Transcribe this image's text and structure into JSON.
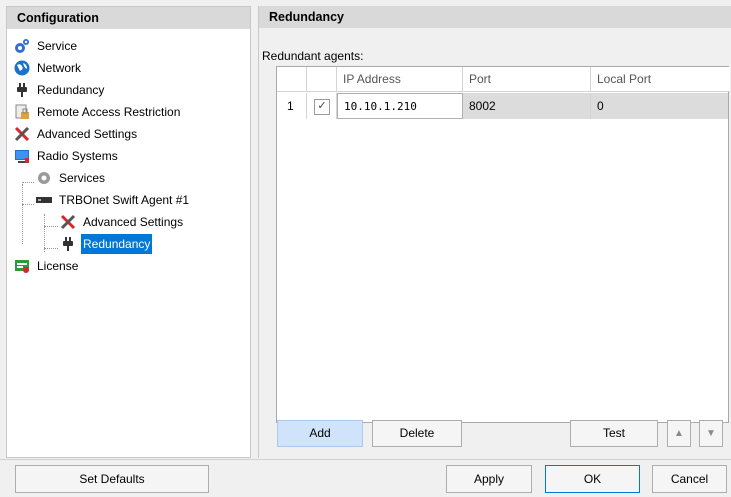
{
  "left_panel": {
    "title": "Configuration",
    "tree": [
      {
        "label": "Service",
        "icon": "service-gear-icon"
      },
      {
        "label": "Network",
        "icon": "network-globe-icon"
      },
      {
        "label": "Redundancy",
        "icon": "plug-icon"
      },
      {
        "label": "Remote Access Restriction",
        "icon": "document-lock-icon"
      },
      {
        "label": "Advanced Settings",
        "icon": "tools-icon"
      },
      {
        "label": "Radio Systems",
        "icon": "monitor-icon"
      },
      {
        "label": "Services",
        "icon": "gear-icon"
      },
      {
        "label": "TRBOnet Swift Agent #1",
        "icon": "device-icon"
      },
      {
        "label": "Advanced Settings",
        "icon": "tools-icon"
      },
      {
        "label": "Redundancy",
        "icon": "plug-icon",
        "selected": true
      },
      {
        "label": "License",
        "icon": "license-icon"
      }
    ]
  },
  "right_panel": {
    "title": "Redundancy",
    "agents_label": "Redundant agents:",
    "columns": [
      "IP Address",
      "Port",
      "Local Port"
    ],
    "rows": [
      {
        "num": "1",
        "checked": "✓",
        "ip": "10.10.1.210",
        "port": "8002",
        "local_port": "0"
      }
    ],
    "buttons": {
      "add": "Add",
      "delete": "Delete",
      "test": "Test",
      "up": "▲",
      "down": "▼"
    }
  },
  "footer": {
    "set_defaults": "Set Defaults",
    "apply": "Apply",
    "ok": "OK",
    "cancel": "Cancel"
  }
}
